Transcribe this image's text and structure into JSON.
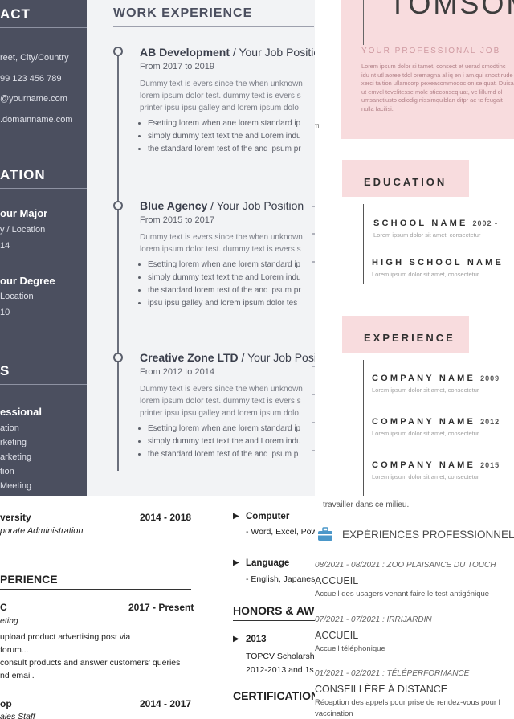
{
  "p1": {
    "side": {
      "contact_heading": "ACT",
      "address": "reet, City/Country",
      "phone": "99 123 456 789",
      "email": "@yourname.com",
      "website": ".domainname.com",
      "education_heading": "ATION",
      "major": "our Major",
      "major_loc": "y / Location",
      "major_year": "14",
      "degree": "our Degree",
      "degree_loc": "Location",
      "degree_year": "10",
      "skills_heading": "S",
      "skill_group": "essional",
      "skills": [
        "ation",
        "rketing",
        "arketing",
        "tion",
        "Meeting"
      ]
    },
    "work_title": "WORK EXPERIENCE",
    "jobs": [
      {
        "company": "AB Development",
        "position": " / Your Job Position",
        "dates": "From 2017 to 2019",
        "para": [
          "Dummy text is evers since the when unknown",
          "lorem ipsum dolor test. dummy text is evers s",
          "printer ipsu ipsu galley  and lorem ipsum dolo"
        ],
        "bullets": [
          "Esetting lorem when ane lorem standard  ip",
          "simply dummy text text the and Lorem indu",
          "the standard lorem test of the and ipsum pr"
        ]
      },
      {
        "company": "Blue Agency",
        "position": " / Your Job Position",
        "dates": "From 2015 to 2017",
        "para": [
          "Dummy text is evers since the when unknown",
          "lorem ipsum dolor test. dummy text is evers s"
        ],
        "bullets": [
          "Esetting lorem when ane lorem standard  ip",
          "simply dummy text text the and Lorem indu",
          "the standard lorem test of the and ipsum pr",
          "ipsu ipsu galley  and lorem ipsum dolor tes"
        ]
      },
      {
        "company": "Creative Zone LTD",
        "position": " / Your Job Positi",
        "dates": "From 2012 to 2014",
        "para": [
          "Dummy text is evers since the when unknown",
          "lorem ipsum dolor test. dummy text is evers s",
          "printer ipsu ipsu galley  and lorem ipsum dolo"
        ],
        "bullets": [
          "Esetting lorem when ane lorem standard  ip",
          "simply dummy text text the and Lorem indu",
          "the standard lorem test of the and ipsum p"
        ]
      }
    ]
  },
  "p2": {
    "name": "TOMSOM",
    "profession": "YOUR PROFESSIONAL JOB",
    "lorem": "Lorem ipsum dolor si tamet, consect et uerad smodtinc idu nt utl aoree tdol oremagna al iq en i am,qui snost rude xerci ta tion ullamcorp pexeacommodoc on se quat. Duisa ut emvel tevelitesse mole stieconseq uat, ve lillumd ol umsanetiusto odiodig nissimquiblan ditpr ae te feugait nulla facilisi.",
    "edge_mark": "m",
    "education_heading": "EDUCATION",
    "schools": [
      {
        "name": "SCHOOL NAME",
        "year": "2002 -",
        "desc": "Lorem ipsum dolor sit amet, consectetur"
      },
      {
        "name": "HIGH SCHOOL NAME",
        "year": "",
        "desc": "Lorem ipsum dolor sit amet, consectetur"
      }
    ],
    "experience_heading": "EXPERIENCE",
    "companies": [
      {
        "name": "COMPANY NAME",
        "year": "2009",
        "desc": "Lorem ipsum dolor sit amet, consectetur"
      },
      {
        "name": "COMPANY NAME",
        "year": "2012",
        "desc": "Lorem ipsum dolor sit amet, consectetur"
      },
      {
        "name": "COMPANY NAME",
        "year": "2015",
        "desc": "Lorem ipsum dolor sit amet, consectetur"
      }
    ]
  },
  "p3": {
    "school": "versity",
    "school_years": "2014 - 2018",
    "school_sub": "porate Administration",
    "exp_heading": "PERIENCE",
    "job1": "C",
    "job1_years": "2017 - Present",
    "job1_role": "eting",
    "job1_lines": [
      "upload product advertising post via",
      "forum...",
      "consult products and answer customers' queries",
      "nd email."
    ],
    "job2": "op",
    "job2_years": "2014 - 2017",
    "job2_role": "ales Staff",
    "computer": "Computer",
    "computer_detail": "- Word, Excel, Pow",
    "language": "Language",
    "language_detail": "- English, Japanes",
    "honors_heading": "HONORS & AW",
    "honor_year": "2013",
    "honor_line1": "TOPCV Scholarsh",
    "honor_line2": "2012-2013 and 1s",
    "cert_heading": "CERTIFICATIONS"
  },
  "p4": {
    "intro": "travailler dans ce milieu.",
    "section_title": "EXPÉRIENCES PROFESSIONNELLE",
    "entries": [
      {
        "date": "08/2021 - 08/2021 : ZOO PLAISANCE DU TOUCH",
        "role": "ACCUEIL",
        "desc": "Accueil des usagers venant faire le test antigénique"
      },
      {
        "date": "07/2021 - 07/2021 : IRRIJARDIN",
        "role": "ACCUEIL",
        "desc": "Accueil téléphonique"
      },
      {
        "date": "01/2021 - 02/2021 : TÉLÉPERFORMANCE",
        "role": "CONSEILLÈRE À DISTANCE",
        "desc": "Réception des appels pour prise de rendez-vous pour l"
      }
    ],
    "last_line": "vaccination"
  }
}
